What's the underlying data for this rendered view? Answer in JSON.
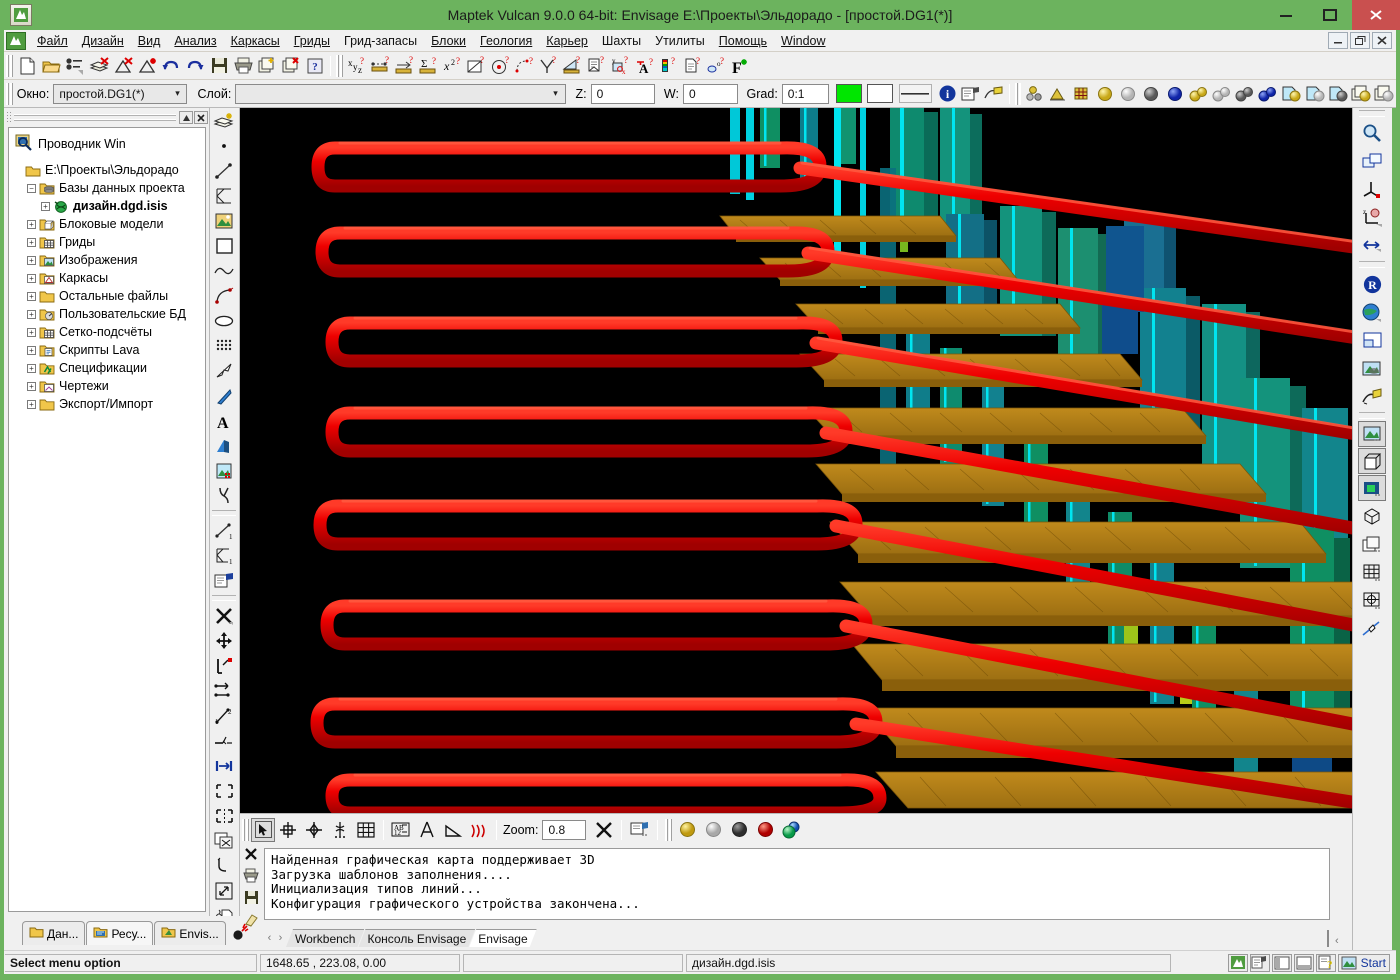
{
  "window": {
    "title": "Maptek Vulcan 9.0.0 64-bit: Envisage  E:\\Проекты\\Эльдорадо - [простой.DG1(*)]",
    "minimize_label": "—",
    "maximize_label": "❐",
    "close_label": "✕",
    "mdi_minimize": "—",
    "mdi_restore": "❐",
    "mdi_close": "✕",
    "accent_color": "#6cb35e",
    "titlebar_close_color": "#c9504f"
  },
  "menubar": {
    "items": [
      {
        "label": "Файл"
      },
      {
        "label": "Дизайн"
      },
      {
        "label": "Вид"
      },
      {
        "label": "Анализ"
      },
      {
        "label": "Каркасы"
      },
      {
        "label": "Гриды"
      },
      {
        "label": "Грид-запасы"
      },
      {
        "label": "Блоки"
      },
      {
        "label": "Геология"
      },
      {
        "label": "Карьер"
      },
      {
        "label": "Шахты"
      },
      {
        "label": "Утилиты"
      },
      {
        "label": "Помощь"
      },
      {
        "label": "Window"
      }
    ]
  },
  "toolbar_main": {
    "icons": [
      {
        "name": "new-file-icon"
      },
      {
        "name": "open-folder-icon"
      },
      {
        "name": "layer-list-icon"
      },
      {
        "name": "delete-layers-icon"
      },
      {
        "name": "delete-triangulation-icon"
      },
      {
        "name": "new-triangulation-icon"
      },
      {
        "name": "undo-icon"
      },
      {
        "name": "redo-icon"
      },
      {
        "name": "save-icon"
      },
      {
        "name": "print-icon"
      },
      {
        "name": "new-window-icon"
      },
      {
        "name": "close-window-icon"
      },
      {
        "name": "help-icon"
      },
      {
        "name": "coordinates-query-icon"
      },
      {
        "name": "measure-distance-icon"
      },
      {
        "name": "measure-offset-icon"
      },
      {
        "name": "sum-length-icon"
      },
      {
        "name": "point-attributes-icon"
      },
      {
        "name": "area-query-icon"
      },
      {
        "name": "circle-center-icon"
      },
      {
        "name": "arc-query-icon"
      },
      {
        "name": "angle-query-icon"
      },
      {
        "name": "slope-query-icon"
      },
      {
        "name": "report-query-icon"
      },
      {
        "name": "image-query-icon"
      },
      {
        "name": "text-query-icon"
      },
      {
        "name": "legend-query-icon"
      },
      {
        "name": "document-query-icon"
      },
      {
        "name": "object-query-icon"
      },
      {
        "name": "formula-new-icon"
      }
    ]
  },
  "toolbar_layer": {
    "window_label": "Окно:",
    "window_value": "простой.DG1(*)",
    "layer_label": "Слой:",
    "layer_value": "",
    "z_label": "Z:",
    "z_value": "0",
    "w_label": "W:",
    "w_value": "0",
    "grad_label": "Grad:",
    "grad_value": "0:1",
    "color_swatch": "#00e600",
    "secondary_swatch": "#ffffff",
    "line_style_name": "solid-line-swatch",
    "info_icon": "info-icon",
    "layer_properties_icon": "layer-properties-icon",
    "layer_paint-icon": "layer-paint-icon",
    "sphere_icons": [
      {
        "name": "group-spheres-icon",
        "color": "#d4b82a"
      },
      {
        "name": "triangulation-shade-icon",
        "color": "#d4b82a"
      },
      {
        "name": "grid-shade-icon",
        "color": "#d4b82a"
      },
      {
        "name": "sphere-yellow-icon",
        "color": "#e8d44d"
      },
      {
        "name": "sphere-white-icon",
        "color": "#dcdcdc"
      },
      {
        "name": "sphere-grey-icon",
        "color": "#808080"
      },
      {
        "name": "sphere-blue-icon",
        "color": "#1a34d0"
      },
      {
        "name": "pair-yellow-icon",
        "color": "#e8d44d"
      },
      {
        "name": "pair-white-icon",
        "color": "#dcdcdc"
      },
      {
        "name": "pair-grey-icon",
        "color": "#808080"
      },
      {
        "name": "pair-blue-icon",
        "color": "#1a34d0"
      },
      {
        "name": "layer-sphere-yellow-icon",
        "color": "#e8d44d"
      },
      {
        "name": "layer-sphere-white-icon",
        "color": "#dcdcdc"
      },
      {
        "name": "layer-sphere-grey-icon",
        "color": "#808080"
      },
      {
        "name": "stack-sphere-yellow-icon",
        "color": "#e8d44d"
      },
      {
        "name": "stack-sphere-white-icon",
        "color": "#dcdcdc"
      }
    ]
  },
  "explorer": {
    "panel_title": "Проводник Win",
    "panel_icon": "explorer-search-icon",
    "collapse_label": "▲",
    "close_label": "✕",
    "root": "E:\\Проекты\\Эльдорадо",
    "tree": [
      {
        "label": "Базы данных проекта",
        "expander": "−",
        "icon": "database-folder-icon",
        "indent": 1,
        "bold": false
      },
      {
        "label": "дизайн.dgd.isis",
        "expander": "+",
        "icon": "isis-design-icon",
        "indent": 2,
        "bold": true
      },
      {
        "label": "Блоковые модели",
        "expander": "+",
        "icon": "block-model-folder-icon",
        "indent": 1,
        "bold": false
      },
      {
        "label": "Гриды",
        "expander": "+",
        "icon": "grid-folder-icon",
        "indent": 1,
        "bold": false
      },
      {
        "label": "Изображения",
        "expander": "+",
        "icon": "image-folder-icon",
        "indent": 1,
        "bold": false
      },
      {
        "label": "Каркасы",
        "expander": "+",
        "icon": "triangulation-folder-icon",
        "indent": 1,
        "bold": false
      },
      {
        "label": "Остальные файлы",
        "expander": "+",
        "icon": "plain-folder-icon",
        "indent": 1,
        "bold": false
      },
      {
        "label": "Пользовательские БД",
        "expander": "+",
        "icon": "user-db-folder-icon",
        "indent": 1,
        "bold": false
      },
      {
        "label": "Сетко-подсчёты",
        "expander": "+",
        "icon": "grid-calc-folder-icon",
        "indent": 1,
        "bold": false
      },
      {
        "label": "Скрипты Lava",
        "expander": "+",
        "icon": "script-folder-icon",
        "indent": 1,
        "bold": false
      },
      {
        "label": "Спецификации",
        "expander": "+",
        "icon": "spec-folder-icon",
        "indent": 1,
        "bold": false
      },
      {
        "label": "Чертежи",
        "expander": "+",
        "icon": "drawing-folder-icon",
        "indent": 1,
        "bold": false
      },
      {
        "label": "Экспорт/Импорт",
        "expander": "+",
        "icon": "plain-folder-icon",
        "indent": 1,
        "bold": false
      }
    ],
    "bottom_tabs": [
      {
        "label": "Дан...",
        "icon": "data-folder-icon",
        "active": false
      },
      {
        "label": "Ресу...",
        "icon": "resource-folder-icon",
        "active": true
      },
      {
        "label": "Envis...",
        "icon": "envisage-folder-icon",
        "active": false
      }
    ],
    "bomb_icon": "bomb-icon"
  },
  "left_palette": {
    "icons": [
      {
        "name": "new-layer-icon"
      },
      {
        "name": "point-tool-icon"
      },
      {
        "name": "line-tool-icon"
      },
      {
        "name": "polyline-tool-icon"
      },
      {
        "name": "image-tool-icon"
      },
      {
        "name": "rectangle-tool-icon"
      },
      {
        "name": "spline-tool-icon"
      },
      {
        "name": "bezier-tool-icon"
      },
      {
        "name": "ellipse-tool-icon"
      },
      {
        "name": "point-grid-tool-icon"
      },
      {
        "name": "arrow-tool-icon"
      },
      {
        "name": "pointer-tool-icon"
      },
      {
        "name": "text-tool-icon"
      },
      {
        "name": "text-3d-tool-icon"
      },
      {
        "name": "image-insert-tool-icon"
      },
      {
        "name": "snap-tool-icon"
      },
      {
        "name": "digitise-line-icon"
      },
      {
        "name": "digitise-polyline-icon"
      },
      {
        "name": "edit-attributes-icon"
      },
      {
        "name": "delete-object-icon"
      },
      {
        "name": "move-object-icon"
      },
      {
        "name": "rotate-point-icon"
      },
      {
        "name": "copy-segment-icon"
      },
      {
        "name": "renumber-points-icon"
      },
      {
        "name": "break-line-icon"
      },
      {
        "name": "snap-to-distance-icon"
      },
      {
        "name": "extend-corners-icon"
      },
      {
        "name": "mirror-object-icon"
      },
      {
        "name": "duplicate-object-icon"
      },
      {
        "name": "fillet-icon"
      },
      {
        "name": "scale-object-icon"
      },
      {
        "name": "copy-to-layer-icon"
      },
      {
        "name": "explode-icon"
      }
    ]
  },
  "right_palette": {
    "icons": [
      {
        "name": "zoom-icon"
      },
      {
        "name": "pan-window-icon"
      },
      {
        "name": "axis-origin-icon"
      },
      {
        "name": "z-rotate-icon"
      },
      {
        "name": "flip-view-icon"
      },
      {
        "name": "reset-view-icon"
      },
      {
        "name": "globe-view-icon"
      },
      {
        "name": "window-layout-icon"
      },
      {
        "name": "render-view-icon"
      },
      {
        "name": "paint-view-icon"
      },
      {
        "name": "image-render-icon"
      },
      {
        "name": "wireframe-box-icon"
      },
      {
        "name": "shaded-box-icon"
      },
      {
        "name": "perspective-box-icon"
      },
      {
        "name": "layers-stack-icon"
      },
      {
        "name": "grid-view-icon"
      },
      {
        "name": "target-grid-icon"
      },
      {
        "name": "section-cut-icon"
      }
    ]
  },
  "viewport_toolbar": {
    "icons": [
      {
        "name": "select-arrow-icon",
        "selected": true
      },
      {
        "name": "crosshair-icon",
        "selected": false
      },
      {
        "name": "center-target-icon",
        "selected": false
      },
      {
        "name": "snap-point-icon",
        "selected": false
      },
      {
        "name": "grid-snap-icon",
        "selected": false
      },
      {
        "name": "label-snap-icon",
        "selected": false
      },
      {
        "name": "compass-snap-icon",
        "selected": false
      },
      {
        "name": "angle-snap-icon",
        "selected": false
      },
      {
        "name": "contour-snap-icon",
        "selected": false
      }
    ],
    "zoom_label": "Zoom:",
    "zoom_value": "0.8",
    "clear_icon": "clear-snap-icon",
    "settings_icon": "snap-settings-icon",
    "spheres": [
      {
        "name": "sphere-yellow-icon",
        "color": "#e0c02a"
      },
      {
        "name": "sphere-white-icon",
        "color": "#dcdcdc"
      },
      {
        "name": "sphere-darkgrey-icon",
        "color": "#555555"
      },
      {
        "name": "sphere-red-icon",
        "color": "#e01010"
      },
      {
        "name": "sphere-multi-icon",
        "color": "#10b060"
      }
    ]
  },
  "console": {
    "gutter_icons": [
      {
        "name": "clear-console-icon",
        "glyph": "✕"
      },
      {
        "name": "print-console-icon",
        "glyph": "printer"
      },
      {
        "name": "save-console-icon",
        "glyph": "disk"
      },
      {
        "name": "erase-console-icon",
        "glyph": "eraser"
      }
    ],
    "lines": [
      "Найденная графическая карта поддерживает 3D",
      "Загрузка шаблонов заполнения....",
      "Инициализация типов линий...",
      "Конфигурация графического устройства закончена..."
    ],
    "nav_prev": "‹",
    "nav_next": "›",
    "tabs": [
      {
        "label": "Workbench",
        "active": false
      },
      {
        "label": "Консоль Envisage",
        "active": false
      },
      {
        "label": "Envisage",
        "active": true
      }
    ],
    "scroll_marker": "‹"
  },
  "statusbar": {
    "message": "Select menu option",
    "coordinates": "1648.65 , 223.08, 0.00",
    "middle_field": "",
    "database": "дизайн.dgd.isis",
    "icons": [
      {
        "name": "envisage-status-icon"
      },
      {
        "name": "properties-status-icon"
      },
      {
        "name": "panel-left-status-icon"
      },
      {
        "name": "panel-bottom-status-icon"
      },
      {
        "name": "help-status-icon"
      },
      {
        "name": "vulcan-start-icon"
      }
    ],
    "start_label": "Start"
  },
  "viewport": {
    "background": "#000000",
    "scene_description": "3D pit design — red haul road ramp strings over a coloured block model with brown bench surfaces",
    "colors": {
      "ramp_string": "#ee0000",
      "bench_surface": "#b5801a",
      "block_teal": "#17907d",
      "block_green": "#0f9a52",
      "block_blue": "#1060a8",
      "block_cyan_edge": "#00e5f0",
      "block_dark_teal": "#116a74"
    }
  }
}
